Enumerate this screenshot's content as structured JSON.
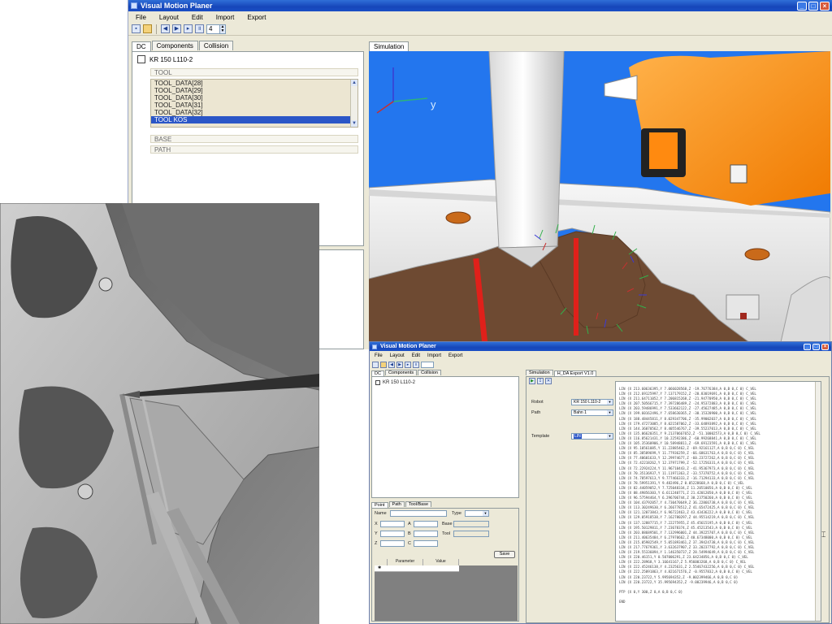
{
  "main_window": {
    "title": "Visual Motion Planer",
    "menu": [
      "File",
      "Layout",
      "Edit",
      "Import",
      "Export"
    ],
    "spinner_value": "4",
    "left_tabs": [
      "DC",
      "Components",
      "Collision"
    ],
    "robot_label": "KR 150 L110-2",
    "groups": {
      "tool": "TOOL",
      "base": "BASE",
      "path": "PATH"
    },
    "tool_items": [
      "TOOL_DATA[28]",
      "TOOL_DATA[29]",
      "TOOL_DATA[30]",
      "TOOL_DATA[31]",
      "TOOL_DATA[32]",
      "TOOL KOS"
    ],
    "selected_tool_index": 5,
    "sim_tab": "Simulation",
    "axis_y_label": "y"
  },
  "secondary_window": {
    "title": "Visual Motion Planer",
    "menu": [
      "File",
      "Layout",
      "Edit",
      "Import",
      "Export"
    ],
    "left_tabs": [
      "DC",
      "Components",
      "Collision"
    ],
    "robot_label": "KR 150 L110-2",
    "right_tabs": [
      "Simulation",
      "H_DA Export V1.0"
    ],
    "form": {
      "robot_label": "Robot",
      "robot_value": "KR 150 L110-2",
      "path_label": "Path",
      "path_value": "Bahn 1",
      "template_label": "Template",
      "template_value": "LIN"
    },
    "point_tabs": [
      "Point",
      "Path",
      "Tool/Base"
    ],
    "point_labels": {
      "name": "Name",
      "type": "Type",
      "x": "X",
      "y": "Y",
      "z": "Z",
      "a": "A",
      "b": "B",
      "c": "C",
      "base": "Base",
      "tool": "Tool"
    },
    "save_label": "Save",
    "grid_headers": [
      "Parameter",
      "Value"
    ],
    "code_lines": [
      "LIN {X 213.60636395,Y 7.066028568,Z -19.76776384,A 0,B 0,C 0} C_VEL",
      "LIN {X 212.69125997,Y 7.137179152,Z -20.83019691,A 0,B 0,C 0} C_VEL",
      "LIN {X 211.64711052,Y 7.206815268,Z -21.94770950,A 0,B 0,C 0} C_VEL",
      "LIN {X 207.50566715,Y 7.397286489,Z -24.95372883,A 0,B 0,C 0} C_VEL",
      "LIN {X 203.59486991,Y 7.533662122,Z -27.45627485,A 0,B 0,C 0} C_VEL",
      "LIN {X 199.60162496,Y 7.658630365,Z -30.15320900,A 0,B 0,C 0} C_VEL",
      "LIN {X 188.48445811,Y 8.029347706,Z -35.99002037,A 0,B 0,C 0} C_VEL",
      "LIN {X 179.47273085,Y 8.021587062,Z -33.64893892,A 0,B 0,C 0} C_VEL",
      "LIN {X 144.36070562,Y 8.405546767,Z -39.55237013,A 0,B 0,C 0} C_VEL",
      "LIN {X 135.06620351,Y 9.21370667652,Z -51.10002573,A 0,B 0,C 0} C_VEL",
      "LIN {X 116.85621431,Y 10.22592386,Z -60.99268841,A 0,B 0,C 0} C_VEL",
      "LIN {X 105.35360906,Y 10.58948811,Z -69.69123591,A 0,B 0,C 0} C_VEL",
      "LIN {X 95.10561085,Y 11.22885462,Z -69.92161127,A 0,B 0,C 0} C_VEL",
      "LIN {X 85.38589699,Y 11.77936259,Z -66.68631763,A 0,B 0,C 0} C_VEL",
      "LIN {X 77.40601633,Y 12.29974677,Z -60.23727262,A 0,B 0,C 0} C_VEL",
      "LIN {X 72.42218262,Y 12.37971799,Z -52.17256331,A 0,B 0,C 0} C_VEL",
      "LIN {X 72.22924224,Y 11.96710443,Z -41.95367973,A 0,B 0,C 0} C_VEL",
      "LIN {X 70.35136937,Y 11.11971363,Z -33.57378752,A 0,B 0,C 0} C_VEL",
      "LIN {X 74.78597613,Y 9.777466333,Z -16.71294133,A 0,B 0,C 0} C_VEL",
      "LIN {X 78.59951391,Y 9.482496,Z 0.05228668,A 0,B 0,C 0} C_VEL",
      "LIN {X 82.44059052,Y 7.725048334,Z 11.20510056,A 0,B 0,C 0} C_VEL",
      "LIN {X 88.49856303,Y 6.611240771,Z 21.42012050,A 0,B 0,C 0} C_VEL",
      "LIN {X 96.57594464,Y 6.296706744,Z 30.23750260,A 0,B 0,C 0} C_VEL",
      "LIN {X 104.43792057,Y 4.730470649,Z 36.22866738,A 0,B 0,C 0} C_VEL",
      "LIN {X 113.30249630,Y 6.266778512,Z 41.65472425,A 0,B 0,C 0} C_VEL",
      "LIN {X 121.12073843,Y 6.96722463,Z 43.43436222,A 0,B 0,C 0} C_VEL",
      "LIN {X 129.05918538,Y 7.162780297,Z 44.95514219,A 0,B 0,C 0} C_VEL",
      "LIN {X 137.12887715,Y 7.22275955,Z 45.45615195,A 0,B 0,C 0} C_VEL",
      "LIN {X 195.50129811,Y 7.23678374,Z 45.45213543,A 0,B 0,C 0} C_VEL",
      "LIN {X 203.88689501,Y 7.132996001,Z 44.39225707,A 0,B 0,C 0} C_VEL",
      "LIN {X 211.40635484,Y 6.27970662,Z 40.67348000,A 0,B 0,C 0} C_VEL",
      "LIN {X 215.05982549,Y 5.051893461,Z 37.39424738,A 0,B 0,C 0} C_VEL",
      "LIN {X 217.77679361,Y 3.632637907,Z 33.20237792,A 0,B 0,C 0} C_VEL",
      "LIN {X 219.55336094,Y 1.146350737,Z 28.54994649,A 0,B 0,C 0} C_VEL",
      "LIN {X 220.46151,Y 0.507006291,Z 23.64234856,A 0,B 0,C 0} C_VEL",
      "LIN {X 222.28968,Y 3.16641167,Z 5.956003268,A 0,B 0,C 0} C_VEL",
      "LIN {X 222.45246138,Y 4.2325631,Z 2.55467432256,A 0,B 0,C 0} C_VEL",
      "LIN {X 222.25891863,Y 4.821671576,Z -0.9557832,A 0,B 0,C 0} C_VEL",
      "LIN {X 220.23722,Y 5.995694352,Z -9.002399466,A 0,B 0,C 0}",
      "LIN {X 220.23722,Y 35.995694352,Z -9.00239946,A 0,B 0,C 0}",
      "",
      "PTP {X 0,Y 300,Z 0,A 0,B 0,C 0}",
      "",
      "END"
    ]
  },
  "colors": {
    "xp_face": "#ece9d8",
    "titlebar": "#1646b9",
    "selection": "#2b56c7",
    "sim_background": "#1f6fe8",
    "robot_orange": "#ff8a10",
    "sheet_metal": "#ececec"
  }
}
